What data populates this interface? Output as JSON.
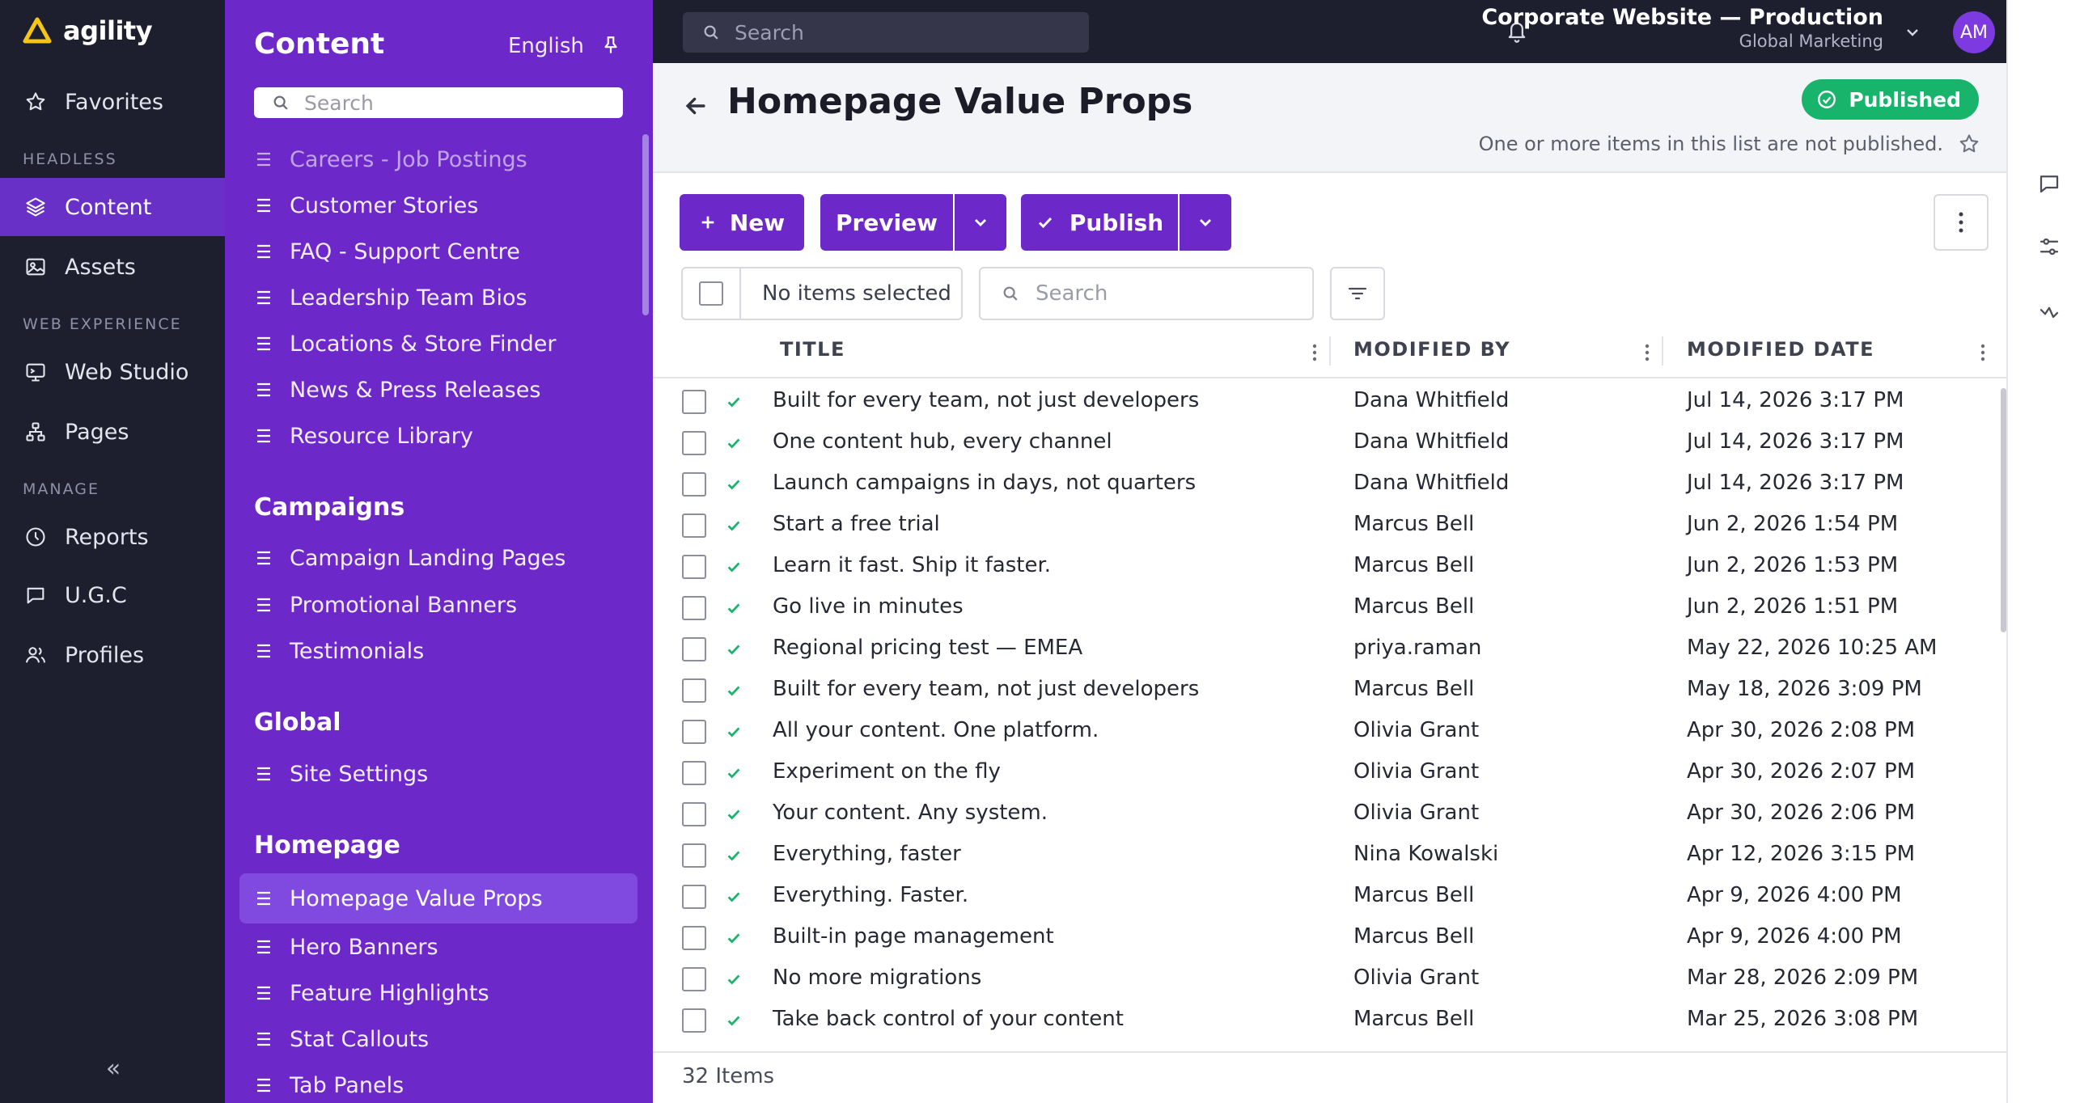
{
  "brand": {
    "name": "agility"
  },
  "leftnav": {
    "favorites": "Favorites",
    "sections": {
      "headless": "HEADLESS",
      "web_experience": "WEB EXPERIENCE",
      "manage": "MANAGE"
    },
    "items": {
      "content": "Content",
      "assets": "Assets",
      "web_studio": "Web Studio",
      "pages": "Pages",
      "reports": "Reports",
      "ugc": "U.G.C",
      "profiles": "Profiles"
    },
    "collapse_glyph": "«"
  },
  "tree": {
    "title": "Content",
    "language": "English",
    "search_placeholder": "Search",
    "top_items": [
      "Careers - Job Postings",
      "Customer Stories",
      "FAQ - Support Centre",
      "Leadership Team Bios",
      "Locations & Store Finder",
      "News & Press Releases",
      "Resource Library"
    ],
    "groups": {
      "campaigns": {
        "title": "Campaigns",
        "items": [
          "Campaign Landing Pages",
          "Promotional Banners",
          "Testimonials"
        ]
      },
      "global": {
        "title": "Global",
        "items": [
          "Site Settings"
        ]
      },
      "homepage": {
        "title": "Homepage",
        "items": [
          "Homepage Value Props",
          "Hero Banners",
          "Feature Highlights",
          "Stat Callouts",
          "Tab Panels"
        ]
      }
    }
  },
  "topbar": {
    "search_placeholder": "Search",
    "site_name": "Corporate Website — Production",
    "site_sub": "Global Marketing",
    "avatar_initials": "AM"
  },
  "header": {
    "title": "Homepage Value Props",
    "status": "Published",
    "warning": "One or more items in this list are not published."
  },
  "toolbar": {
    "new_label": "New",
    "preview_label": "Preview",
    "publish_label": "Publish",
    "selection_label": "No items selected",
    "search_placeholder": "Search"
  },
  "table": {
    "columns": {
      "title": "TITLE",
      "modified_by": "MODIFIED BY",
      "modified_date": "MODIFIED DATE"
    },
    "rows": [
      {
        "title": "Built for every team, not just developers",
        "by": "Dana Whitfield",
        "date": "Jul 14, 2026 3:17 PM"
      },
      {
        "title": "One content hub, every channel",
        "by": "Dana Whitfield",
        "date": "Jul 14, 2026 3:17 PM"
      },
      {
        "title": "Launch campaigns in days, not quarters",
        "by": "Dana Whitfield",
        "date": "Jul 14, 2026 3:17 PM"
      },
      {
        "title": "Start a free trial",
        "by": "Marcus Bell",
        "date": "Jun 2, 2026 1:54 PM"
      },
      {
        "title": "Learn it fast. Ship it faster.",
        "by": "Marcus Bell",
        "date": "Jun 2, 2026 1:53 PM"
      },
      {
        "title": "Go live in minutes",
        "by": "Marcus Bell",
        "date": "Jun 2, 2026 1:51 PM"
      },
      {
        "title": "Regional pricing test — EMEA",
        "by": "priya.raman",
        "date": "May 22, 2026 10:25 AM"
      },
      {
        "title": "Built for every team, not just developers",
        "by": "Marcus Bell",
        "date": "May 18, 2026 3:09 PM"
      },
      {
        "title": "All your content. One platform.",
        "by": "Olivia Grant",
        "date": "Apr 30, 2026 2:08 PM"
      },
      {
        "title": "Experiment on the fly",
        "by": "Olivia Grant",
        "date": "Apr 30, 2026 2:07 PM"
      },
      {
        "title": "Your content. Any system.",
        "by": "Olivia Grant",
        "date": "Apr 30, 2026 2:06 PM"
      },
      {
        "title": "Everything, faster",
        "by": "Nina Kowalski",
        "date": "Apr 12, 2026 3:15 PM"
      },
      {
        "title": "Everything. Faster.",
        "by": "Marcus Bell",
        "date": "Apr 9, 2026 4:00 PM"
      },
      {
        "title": "Built-in page management",
        "by": "Marcus Bell",
        "date": "Apr 9, 2026 4:00 PM"
      },
      {
        "title": "No more migrations",
        "by": "Olivia Grant",
        "date": "Mar 28, 2026 2:09 PM"
      },
      {
        "title": "Take back control of your content",
        "by": "Marcus Bell",
        "date": "Mar 25, 2026 3:08 PM"
      }
    ],
    "item_count": "32 Items"
  },
  "colors": {
    "nav_bg": "#1e1f2e",
    "accent": "#6d28c9",
    "nav_active": "#6930c8",
    "status_green": "#19b46b",
    "brand_yellow": "#f5c518"
  },
  "icons": {
    "logo": "triangle-logo-icon",
    "favorites": "star-icon",
    "content": "layers-icon",
    "assets": "image-icon",
    "web_studio": "monitor-icon",
    "pages": "sitemap-icon",
    "reports": "clock-icon",
    "ugc": "chat-icon",
    "profiles": "users-icon"
  }
}
